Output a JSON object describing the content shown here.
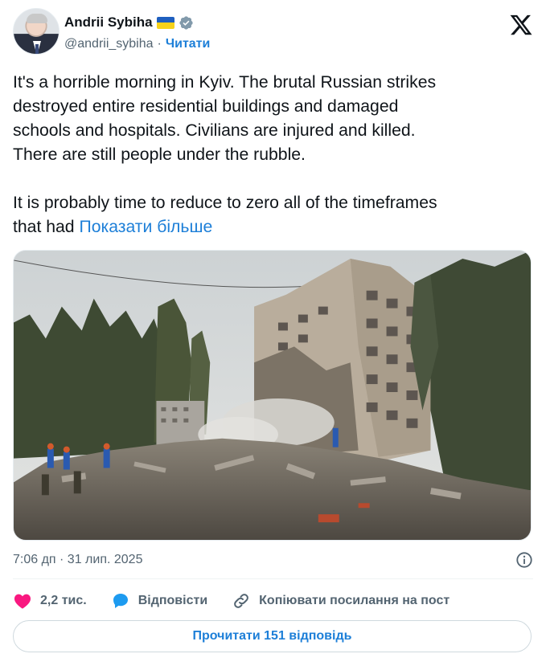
{
  "author": {
    "name": "Andrii Sybiha",
    "handle": "@andrii_sybiha",
    "separator": "·",
    "follow_label": "Читати"
  },
  "tweet": {
    "lines": [
      "It's a horrible morning in Kyiv. The brutal Russian strikes",
      "destroyed entire residential buildings and damaged",
      "schools and hospitals. Civilians are injured and killed.",
      "There are still people under the rubble."
    ],
    "line5": "It is probably time to reduce to zero all of the timeframes",
    "line6_prefix": "that had ",
    "show_more": "Показати більше"
  },
  "timestamp": "7:06 дп · 31 лип. 2025",
  "actions": {
    "likes": "2,2 тис.",
    "reply": "Відповісти",
    "copy_link": "Копіювати посилання на пост"
  },
  "read_replies": "Прочитати 151 відповідь",
  "icons": {
    "logo": "x-logo-icon",
    "verified": "verified-badge-icon",
    "flag": "ukraine-flag-icon",
    "info": "info-icon",
    "like": "heart-icon",
    "reply": "speech-bubble-icon",
    "link": "link-icon"
  },
  "colors": {
    "accent": "#1d7fd8",
    "like": "#f91880",
    "text": "#0f1419",
    "muted": "#536471"
  }
}
